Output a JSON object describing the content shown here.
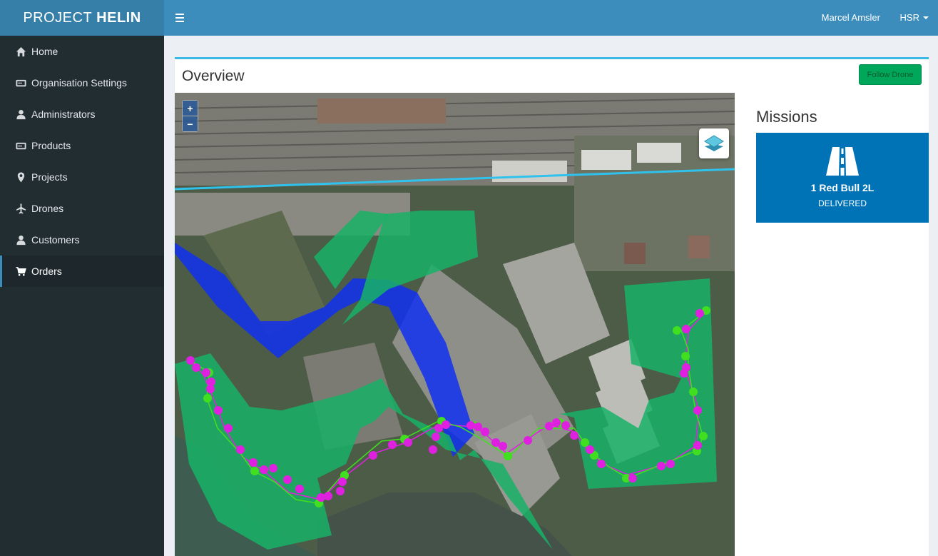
{
  "app": {
    "logo_light": "PROJECT",
    "logo_bold": "HELIN"
  },
  "sidebar": {
    "items": [
      {
        "label": "Home",
        "icon": "home-icon"
      },
      {
        "label": "Organisation Settings",
        "icon": "settings-box-icon"
      },
      {
        "label": "Administrators",
        "icon": "user-icon"
      },
      {
        "label": "Products",
        "icon": "product-box-icon"
      },
      {
        "label": "Projects",
        "icon": "map-marker-icon"
      },
      {
        "label": "Drones",
        "icon": "plane-icon"
      },
      {
        "label": "Customers",
        "icon": "user-icon"
      },
      {
        "label": "Orders",
        "icon": "cart-icon",
        "active": true
      }
    ]
  },
  "header": {
    "user_name": "Marcel Amsler",
    "org": "HSR"
  },
  "overview": {
    "title": "Overview",
    "follow_button": "Follow Drone"
  },
  "map": {
    "zoom_in": "+",
    "zoom_out": "−"
  },
  "missions": {
    "title": "Missions",
    "items": [
      {
        "name": "1 Red Bull 2L",
        "status": "DELIVERED",
        "icon": "road-icon"
      }
    ]
  },
  "colors": {
    "header": "#3c8dbc",
    "logo": "#367fa9",
    "sidebar": "#222d32",
    "accent": "#3cb8e4",
    "button": "#00a65a",
    "mission": "#0073b7",
    "zone_green": "#17b266",
    "zone_blue": "#1030f0",
    "route_magenta": "#e020e0",
    "route_green": "#40e020"
  }
}
